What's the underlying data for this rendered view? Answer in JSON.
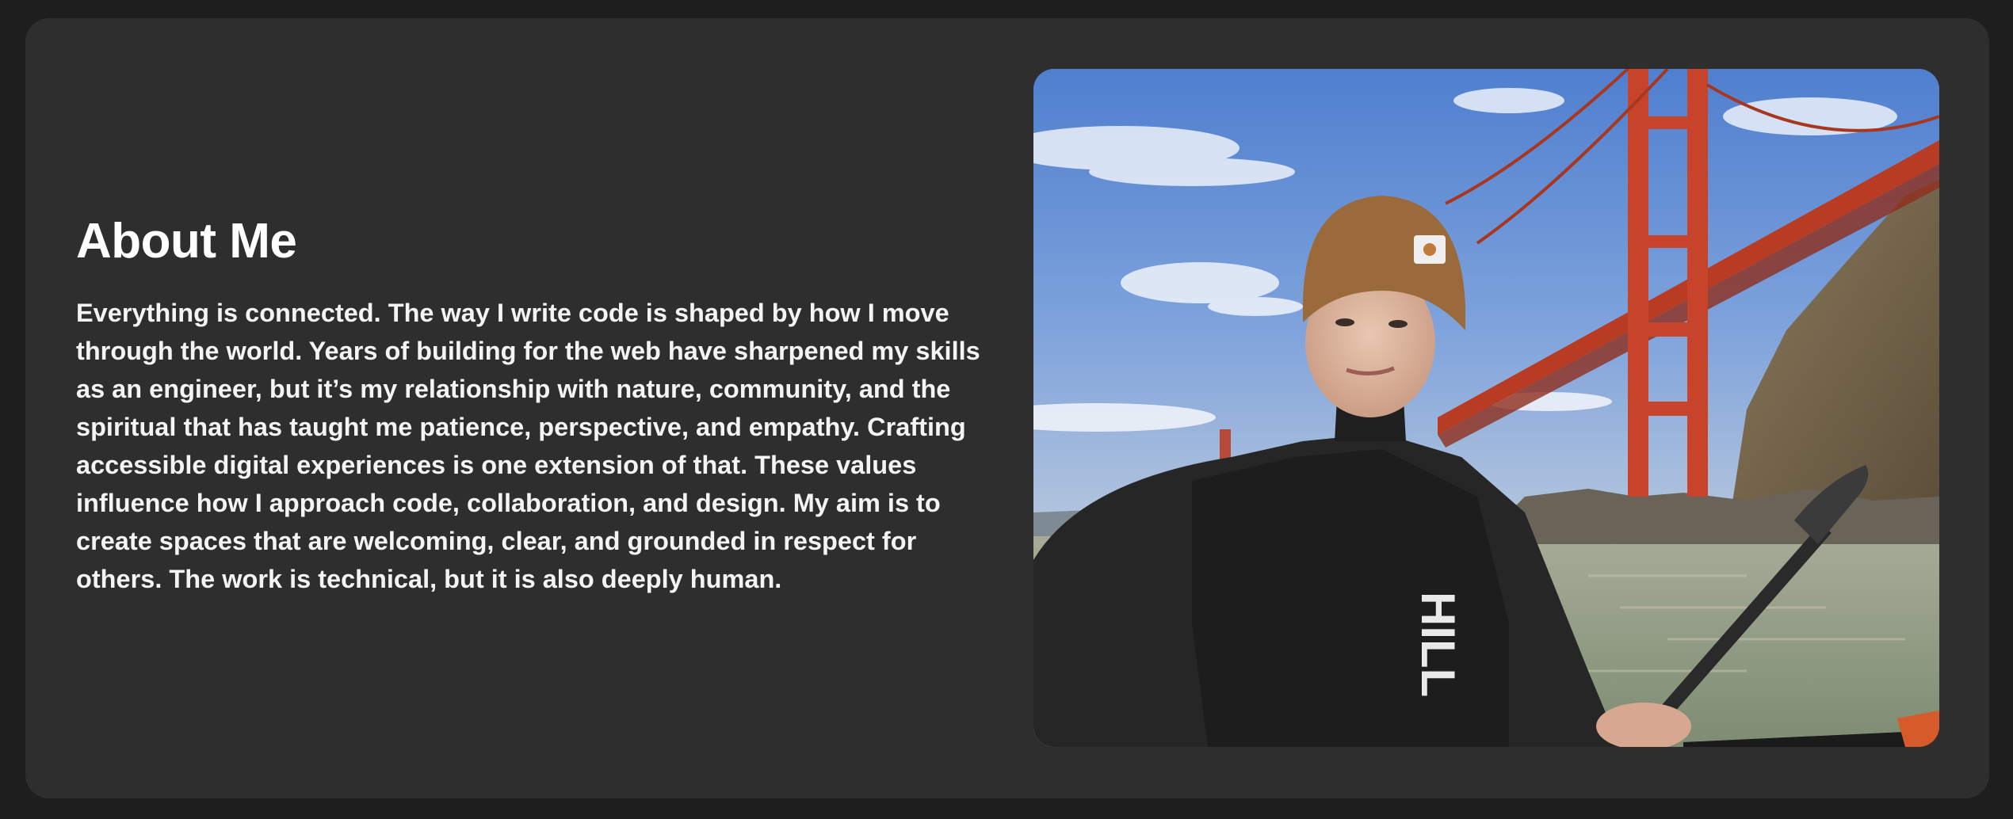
{
  "about": {
    "title": "About Me",
    "body": "Everything is connected. The way I write code is shaped by how I move through the world. Years of building for the web have sharpened my skills as an engineer, but it’s my relationship with nature, community, and the spiritual that has taught me patience, perspective, and empathy. Crafting accessible digital experiences is one extension of that. These values influence how I approach code, collaboration, and design. My aim is to create spaces that are welcoming, clear, and grounded in respect for others. The work is technical, but it is also deeply human."
  },
  "photo": {
    "wetsuit_text": "HILL",
    "colors": {
      "sky": "#6f95d6",
      "bridge": "#c7432a",
      "water": "#9aa68a",
      "beanie": "#9a6a3a"
    }
  }
}
